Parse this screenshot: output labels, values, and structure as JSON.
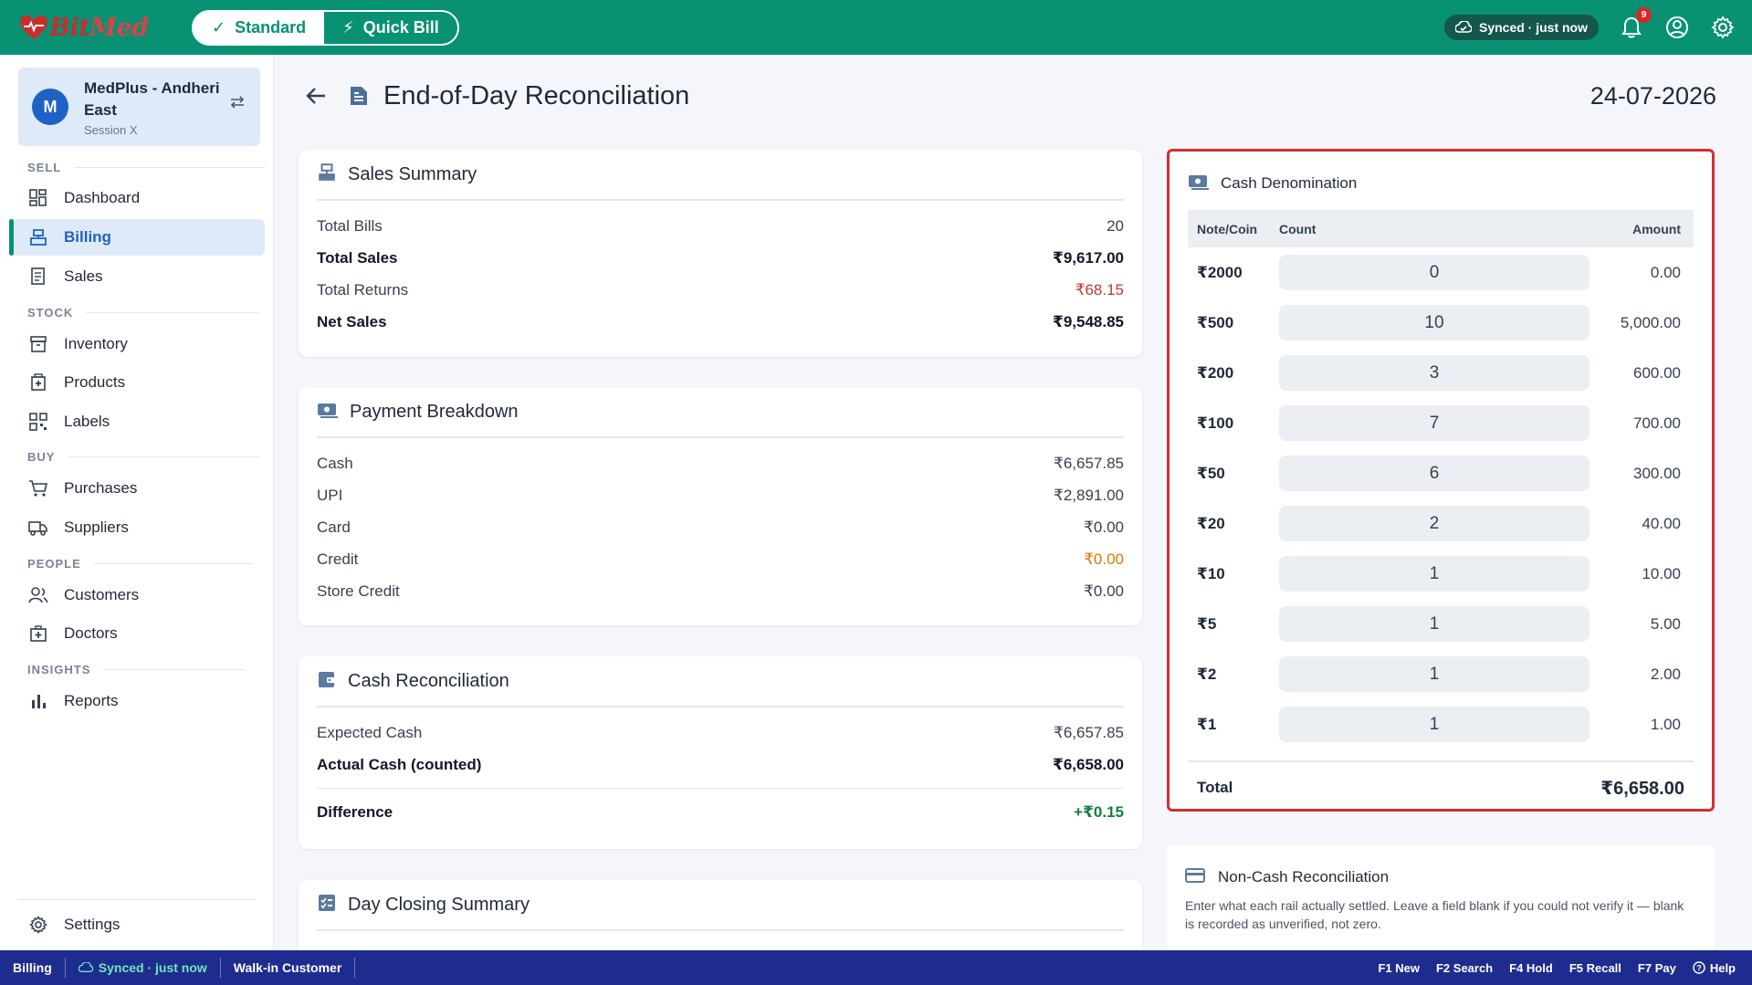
{
  "app": {
    "logo_text_a": "Bit",
    "logo_text_b": "Med",
    "mode_standard": "Standard",
    "mode_quick": "Quick Bill",
    "sync_status": "Synced · just now",
    "notification_count": "9"
  },
  "store": {
    "avatar_letter": "M",
    "name": "MedPlus - Andheri East",
    "session": "Session X"
  },
  "nav": {
    "sections": {
      "sell": "SELL",
      "stock": "STOCK",
      "buy": "BUY",
      "people": "PEOPLE",
      "insights": "INSIGHTS"
    },
    "items": {
      "dashboard": "Dashboard",
      "billing": "Billing",
      "sales": "Sales",
      "inventory": "Inventory",
      "products": "Products",
      "labels": "Labels",
      "purchases": "Purchases",
      "suppliers": "Suppliers",
      "customers": "Customers",
      "doctors": "Doctors",
      "reports": "Reports",
      "settings": "Settings"
    },
    "active": "billing"
  },
  "page": {
    "title": "End-of-Day Reconciliation",
    "date": "24-07-2026"
  },
  "sales_summary": {
    "title": "Sales Summary",
    "rows": [
      {
        "label": "Total Bills",
        "value": "20"
      },
      {
        "label": "Total Sales",
        "value": "₹9,617.00"
      },
      {
        "label": "Total Returns",
        "value": "₹68.15"
      },
      {
        "label": "Net Sales",
        "value": "₹9,548.85"
      }
    ]
  },
  "payment_breakdown": {
    "title": "Payment Breakdown",
    "rows": [
      {
        "label": "Cash",
        "value": "₹6,657.85"
      },
      {
        "label": "UPI",
        "value": "₹2,891.00"
      },
      {
        "label": "Card",
        "value": "₹0.00"
      },
      {
        "label": "Credit",
        "value": "₹0.00"
      },
      {
        "label": "Store Credit",
        "value": "₹0.00"
      }
    ]
  },
  "cash_reconciliation": {
    "title": "Cash Reconciliation",
    "rows": [
      {
        "label": "Expected Cash",
        "value": "₹6,657.85"
      },
      {
        "label": "Actual Cash (counted)",
        "value": "₹6,658.00"
      },
      {
        "label": "Difference",
        "value": "+₹0.15"
      }
    ]
  },
  "day_closing": {
    "title": "Day Closing Summary"
  },
  "cash_denomination": {
    "title": "Cash Denomination",
    "headers": {
      "note": "Note/Coin",
      "count": "Count",
      "amount": "Amount"
    },
    "rows": [
      {
        "note": "₹2000",
        "count": "0",
        "amount": "0.00"
      },
      {
        "note": "₹500",
        "count": "10",
        "amount": "5,000.00"
      },
      {
        "note": "₹200",
        "count": "3",
        "amount": "600.00"
      },
      {
        "note": "₹100",
        "count": "7",
        "amount": "700.00"
      },
      {
        "note": "₹50",
        "count": "6",
        "amount": "300.00"
      },
      {
        "note": "₹20",
        "count": "2",
        "amount": "40.00"
      },
      {
        "note": "₹10",
        "count": "1",
        "amount": "10.00"
      },
      {
        "note": "₹5",
        "count": "1",
        "amount": "5.00"
      },
      {
        "note": "₹2",
        "count": "1",
        "amount": "2.00"
      },
      {
        "note": "₹1",
        "count": "1",
        "amount": "1.00"
      }
    ],
    "total_label": "Total",
    "total_value": "₹6,658.00"
  },
  "non_cash": {
    "title": "Non-Cash Reconciliation",
    "description": "Enter what each rail actually settled. Leave a field blank if you could not verify it — blank is recorded as unverified, not zero."
  },
  "statusbar": {
    "screen": "Billing",
    "sync": "Synced · just now",
    "customer": "Walk-in Customer",
    "shortcuts": [
      "F1 New",
      "F2 Search",
      "F4 Hold",
      "F5 Recall",
      "F7 Pay"
    ],
    "help": "Help"
  },
  "colors": {
    "brand": "#089173",
    "accent": "#1e63c4",
    "highlight_border": "#d32f2f",
    "statusbar": "#1f2c8f"
  }
}
